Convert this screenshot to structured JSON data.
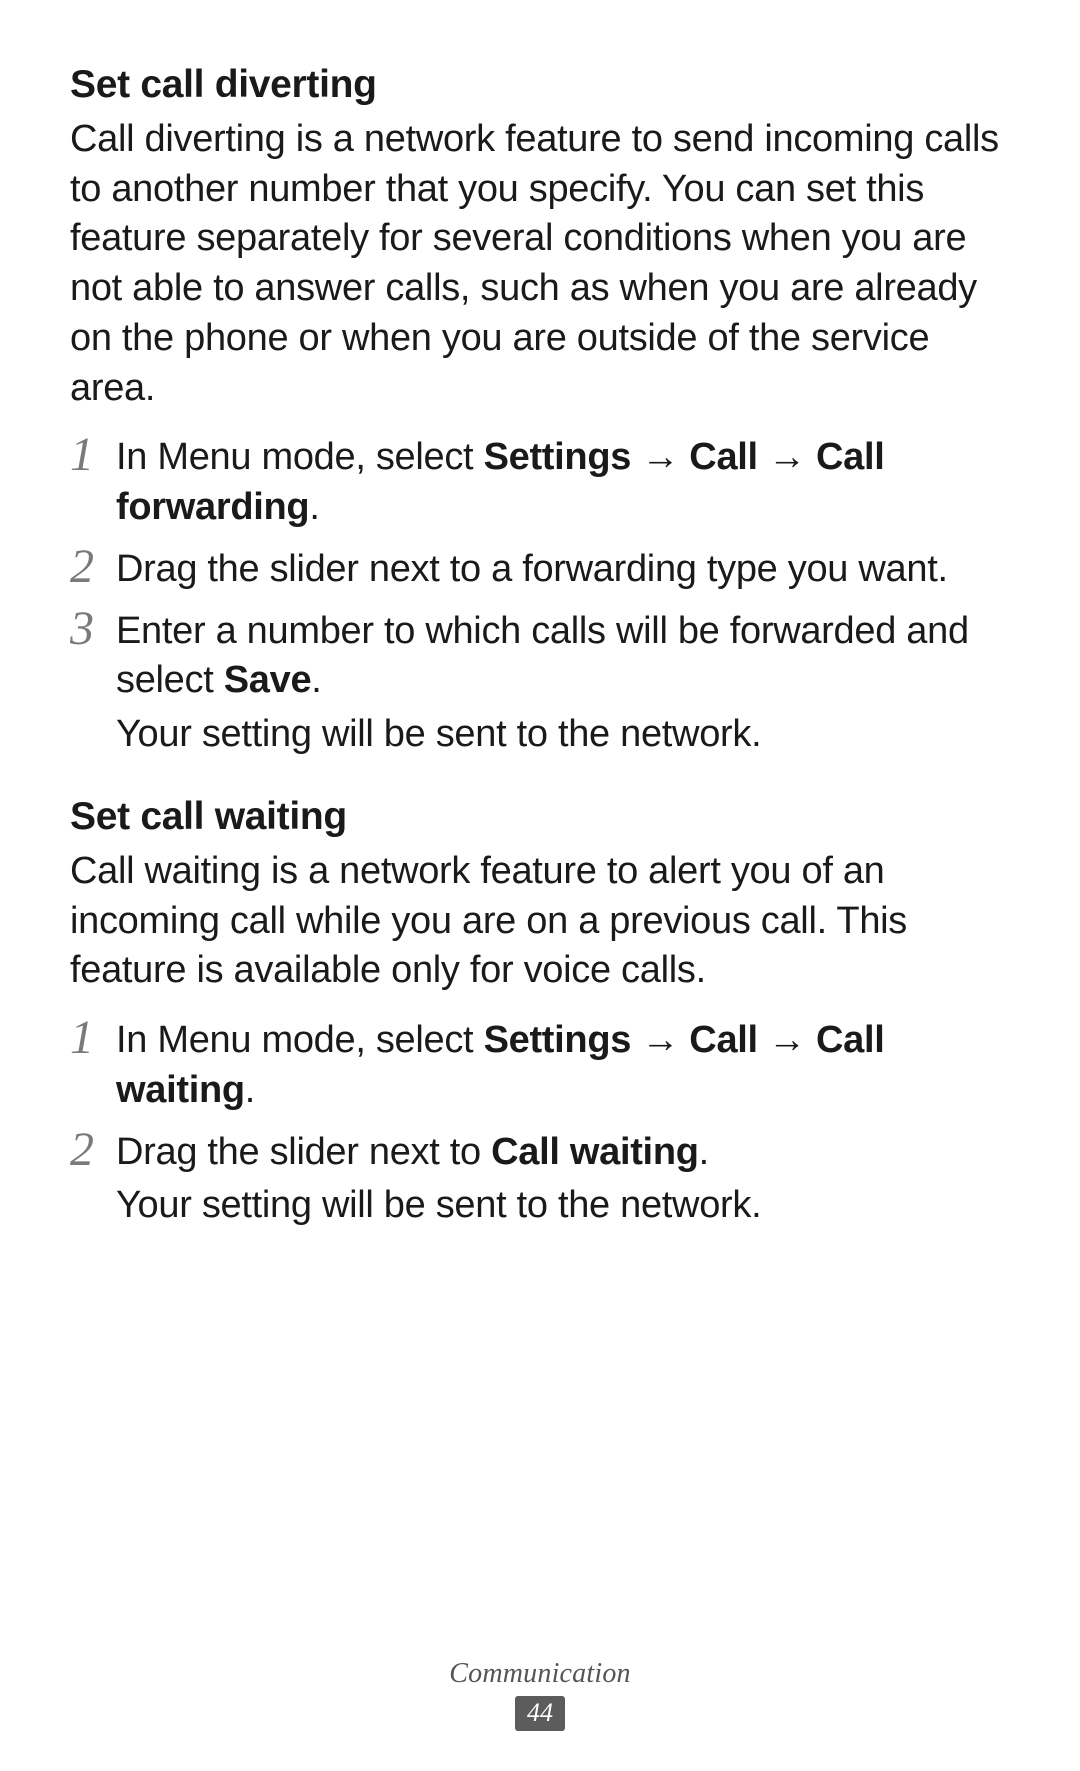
{
  "section1": {
    "heading": "Set call diverting",
    "body": "Call diverting is a network feature to send incoming calls to another number that you specify. You can set this feature separately for several conditions when you are not able to answer calls, such as when you are already on the phone or when you are outside of the service area.",
    "steps": [
      {
        "num": "1",
        "pre": "In Menu mode, select ",
        "b1": "Settings",
        "a1": " → ",
        "b2": "Call",
        "a2": " → ",
        "b3": "Call forwarding",
        "post": "."
      },
      {
        "num": "2",
        "text": "Drag the slider next to a forwarding type you want."
      },
      {
        "num": "3",
        "line1_pre": "Enter a number to which calls will be forwarded and select ",
        "line1_b": "Save",
        "line1_post": ".",
        "line2": "Your setting will be sent to the network."
      }
    ]
  },
  "section2": {
    "heading": "Set call waiting",
    "body": "Call waiting is a network feature to alert you of an incoming call while you are on a previous call. This feature is available only for voice calls.",
    "steps": [
      {
        "num": "1",
        "pre": "In Menu mode, select ",
        "b1": "Settings",
        "a1": " → ",
        "b2": "Call",
        "a2": " → ",
        "b3": "Call waiting",
        "post": "."
      },
      {
        "num": "2",
        "line1_pre": "Drag the slider next to ",
        "line1_b": "Call waiting",
        "line1_post": ".",
        "line2": "Your setting will be sent to the network."
      }
    ]
  },
  "footer": {
    "section": "Communication",
    "page": "44"
  }
}
